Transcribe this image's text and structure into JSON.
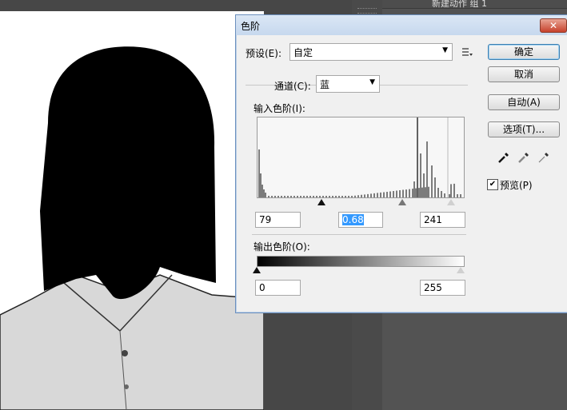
{
  "background": {
    "layers_panel_label": "新建动作  组 1"
  },
  "dialog": {
    "title": "色阶",
    "close_glyph": "✕",
    "preset_label": "预设(E):",
    "preset_value": "自定",
    "channel_label": "通道(C):",
    "channel_value": "蓝",
    "input_levels_label": "输入色阶(I):",
    "input_black": "79",
    "input_gamma": "0.68",
    "input_white": "241",
    "output_levels_label": "输出色阶(O):",
    "output_black": "0",
    "output_white": "255",
    "buttons": {
      "ok": "确定",
      "cancel": "取消",
      "auto": "自动(A)",
      "options": "选项(T)..."
    },
    "preview_label": "预览(P)",
    "preview_checked": true
  }
}
